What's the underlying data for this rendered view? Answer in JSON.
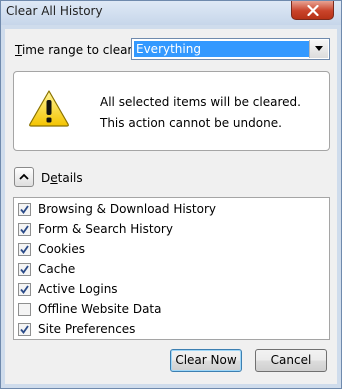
{
  "window": {
    "title": "Clear All History"
  },
  "time_range": {
    "label_accel": "T",
    "label_rest": "ime range to clear:",
    "selected": "Everything"
  },
  "warning": {
    "line1": "All selected items will be cleared.",
    "line2": "This action cannot be undone."
  },
  "details": {
    "label_prefix": "D",
    "label_accel": "e",
    "label_rest": "tails"
  },
  "items": [
    {
      "label": "Browsing & Download History",
      "checked": true
    },
    {
      "label": "Form & Search History",
      "checked": true
    },
    {
      "label": "Cookies",
      "checked": true
    },
    {
      "label": "Cache",
      "checked": true
    },
    {
      "label": "Active Logins",
      "checked": true
    },
    {
      "label": "Offline Website Data",
      "checked": false
    },
    {
      "label": "Site Preferences",
      "checked": true
    }
  ],
  "buttons": {
    "clear_now": "Clear Now",
    "cancel": "Cancel"
  }
}
